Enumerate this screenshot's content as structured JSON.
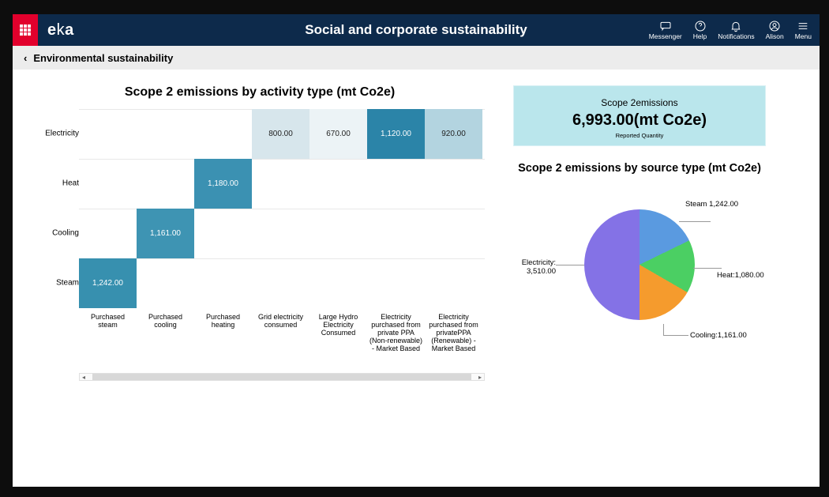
{
  "header": {
    "logo": "eka",
    "title": "Social and corporate sustainability",
    "items": [
      {
        "label": "Messenger"
      },
      {
        "label": "Help"
      },
      {
        "label": "Notifications"
      },
      {
        "label": "Alison"
      },
      {
        "label": "Menu"
      }
    ]
  },
  "breadcrumb": {
    "text": "Environmental sustainability"
  },
  "left": {
    "title": "Scope 2 emissions by activity type (mt Co2e)",
    "rows": [
      "Electricity",
      "Heat",
      "Cooling",
      "Steam"
    ],
    "cols": [
      "Purchased steam",
      "Purchased cooling",
      "Purchased heating",
      "Grid electricity consumed",
      "Large Hydro Electricity Consumed",
      "Electricity purchased from private PPA (Non-renewable) - Market Based",
      "Electricity purchased from privatePPA (Renewable) - Market Based"
    ],
    "cells": {
      "r0c3": "800.00",
      "r0c4": "670.00",
      "r0c5": "1,120.00",
      "r0c6": "920.00",
      "r1c2": "1,180.00",
      "r2c1": "1,161.00",
      "r3c0": "1,242.00"
    }
  },
  "kpi": {
    "title": "Scope 2emissions",
    "value": "6,993.00(mt Co2e)",
    "sub": "Reported Quantity"
  },
  "pie": {
    "title": "Scope 2 emissions by source type (mt Co2e)",
    "labels": {
      "steam": "Steam 1,242.00",
      "heat": "Heat:1,080.00",
      "cooling": "Cooling:1,161.00",
      "electricity": "Electricity: 3,510.00"
    }
  },
  "chart_data": [
    {
      "type": "heatmap",
      "title": "Scope 2 emissions by activity type (mt Co2e)",
      "y_categories": [
        "Electricity",
        "Heat",
        "Cooling",
        "Steam"
      ],
      "x_categories": [
        "Purchased steam",
        "Purchased cooling",
        "Purchased heating",
        "Grid electricity consumed",
        "Large Hydro Electricity Consumed",
        "Electricity purchased from private PPA (Non-renewable) - Market Based",
        "Electricity purchased from privatePPA (Renewable) - Market Based"
      ],
      "values": [
        [
          null,
          null,
          null,
          800.0,
          670.0,
          1120.0,
          920.0
        ],
        [
          null,
          null,
          1180.0,
          null,
          null,
          null,
          null
        ],
        [
          null,
          1161.0,
          null,
          null,
          null,
          null,
          null
        ],
        [
          1242.0,
          null,
          null,
          null,
          null,
          null,
          null
        ]
      ],
      "unit": "mt Co2e"
    },
    {
      "type": "pie",
      "title": "Scope 2 emissions by source type (mt Co2e)",
      "series": [
        {
          "name": "Steam",
          "value": 1242.0
        },
        {
          "name": "Heat",
          "value": 1080.0
        },
        {
          "name": "Cooling",
          "value": 1161.0
        },
        {
          "name": "Electricity",
          "value": 3510.0
        }
      ],
      "total": 6993.0,
      "unit": "mt Co2e"
    }
  ]
}
